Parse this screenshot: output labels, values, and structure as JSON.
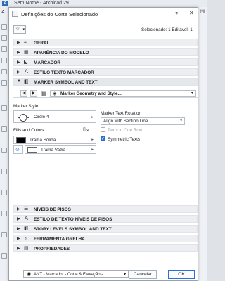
{
  "app": {
    "title": "Sem Nome - Archicad 29",
    "left_tab": "A",
    "right_tab": "Ml"
  },
  "dialog": {
    "title": "Definições do Corte Selecionado",
    "help": "?",
    "close": "✕",
    "selection_info": "Selecionado: 1 Editável: 1",
    "sections_top": [
      {
        "label": "GERAL",
        "icon": "section-general-icon",
        "glyph": "⌗"
      },
      {
        "label": "APARÊNCIA DO MODELO",
        "icon": "model-appearance-icon",
        "glyph": "▦"
      },
      {
        "label": "MARCADOR",
        "icon": "marker-icon",
        "glyph": "◣"
      },
      {
        "label": "ESTILO TEXTO MARCADOR",
        "icon": "marker-text-style-icon",
        "glyph": "Ａ"
      },
      {
        "label": "MARKER SYMBOL AND TEXT",
        "icon": "marker-symbol-icon",
        "glyph": "◧"
      }
    ],
    "subpage": {
      "label": "Marker Geometry and Style..."
    },
    "marker_style": {
      "heading": "Marker Style",
      "value": "Circle 4"
    },
    "fills": {
      "heading": "Fills and Colors",
      "fill1": "Trama Sólida",
      "fill2": "Trama Vazia",
      "fill1_color": "#000000",
      "fill2_color": "#ffffff"
    },
    "text_rotation": {
      "heading": "Marker Text Rotation",
      "value": "Align with Section Line"
    },
    "texts_one_row": {
      "label": "Texts in One Row",
      "checked": false
    },
    "symmetric_texts": {
      "label": "Symmetric Texts",
      "checked": true
    },
    "sections_bottom": [
      {
        "label": "NÍVEIS DE PISOS",
        "icon": "story-levels-icon",
        "glyph": "☰"
      },
      {
        "label": "ESTILO DE TEXTO NÍVEIS DE PISOS",
        "icon": "story-text-style-icon",
        "glyph": "Ａ"
      },
      {
        "label": "STORY LEVELS SYMBOL AND TEXT",
        "icon": "story-symbol-icon",
        "glyph": "◧"
      },
      {
        "label": "FERRAMENTA GRELHA",
        "icon": "grid-tool-icon",
        "glyph": "♁"
      },
      {
        "label": "PROPRIEDADES",
        "icon": "properties-icon",
        "glyph": "▤"
      }
    ],
    "footer": {
      "favorite": "ANT - Marcador - Corte & Elevação - ...",
      "cancel": "Cancelar",
      "ok": "OK"
    }
  }
}
